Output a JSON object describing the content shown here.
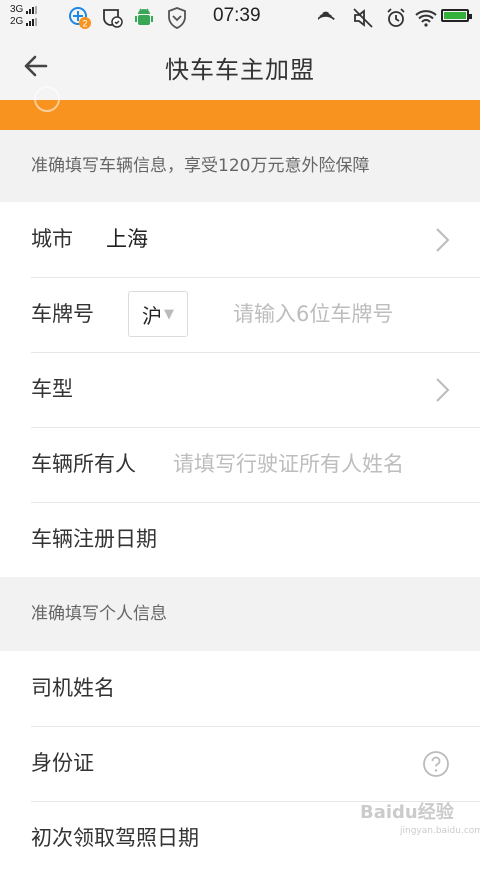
{
  "status": {
    "net_top": "3G",
    "net_bottom": "2G",
    "notification_badge": "2",
    "time": "07:39"
  },
  "header": {
    "title": "快车车主加盟"
  },
  "vehicle_section": {
    "hint": "准确填写车辆信息，享受120万元意外险保障",
    "city_label": "城市",
    "city_value": "上海",
    "plate_label": "车牌号",
    "plate_prefix": "沪",
    "plate_placeholder": "请输入6位车牌号",
    "model_label": "车型",
    "owner_label": "车辆所有人",
    "owner_placeholder": "请填写行驶证所有人姓名",
    "reg_date_label": "车辆注册日期"
  },
  "personal_section": {
    "hint": "准确填写个人信息",
    "driver_name_label": "司机姓名",
    "id_label": "身份证",
    "license_date_label": "初次领取驾照日期"
  },
  "watermark": {
    "brand": "Baidu经验",
    "url": "jingyan.baidu.com"
  },
  "colors": {
    "accent_orange": "#f7931e",
    "battery_green": "#33b13b"
  }
}
